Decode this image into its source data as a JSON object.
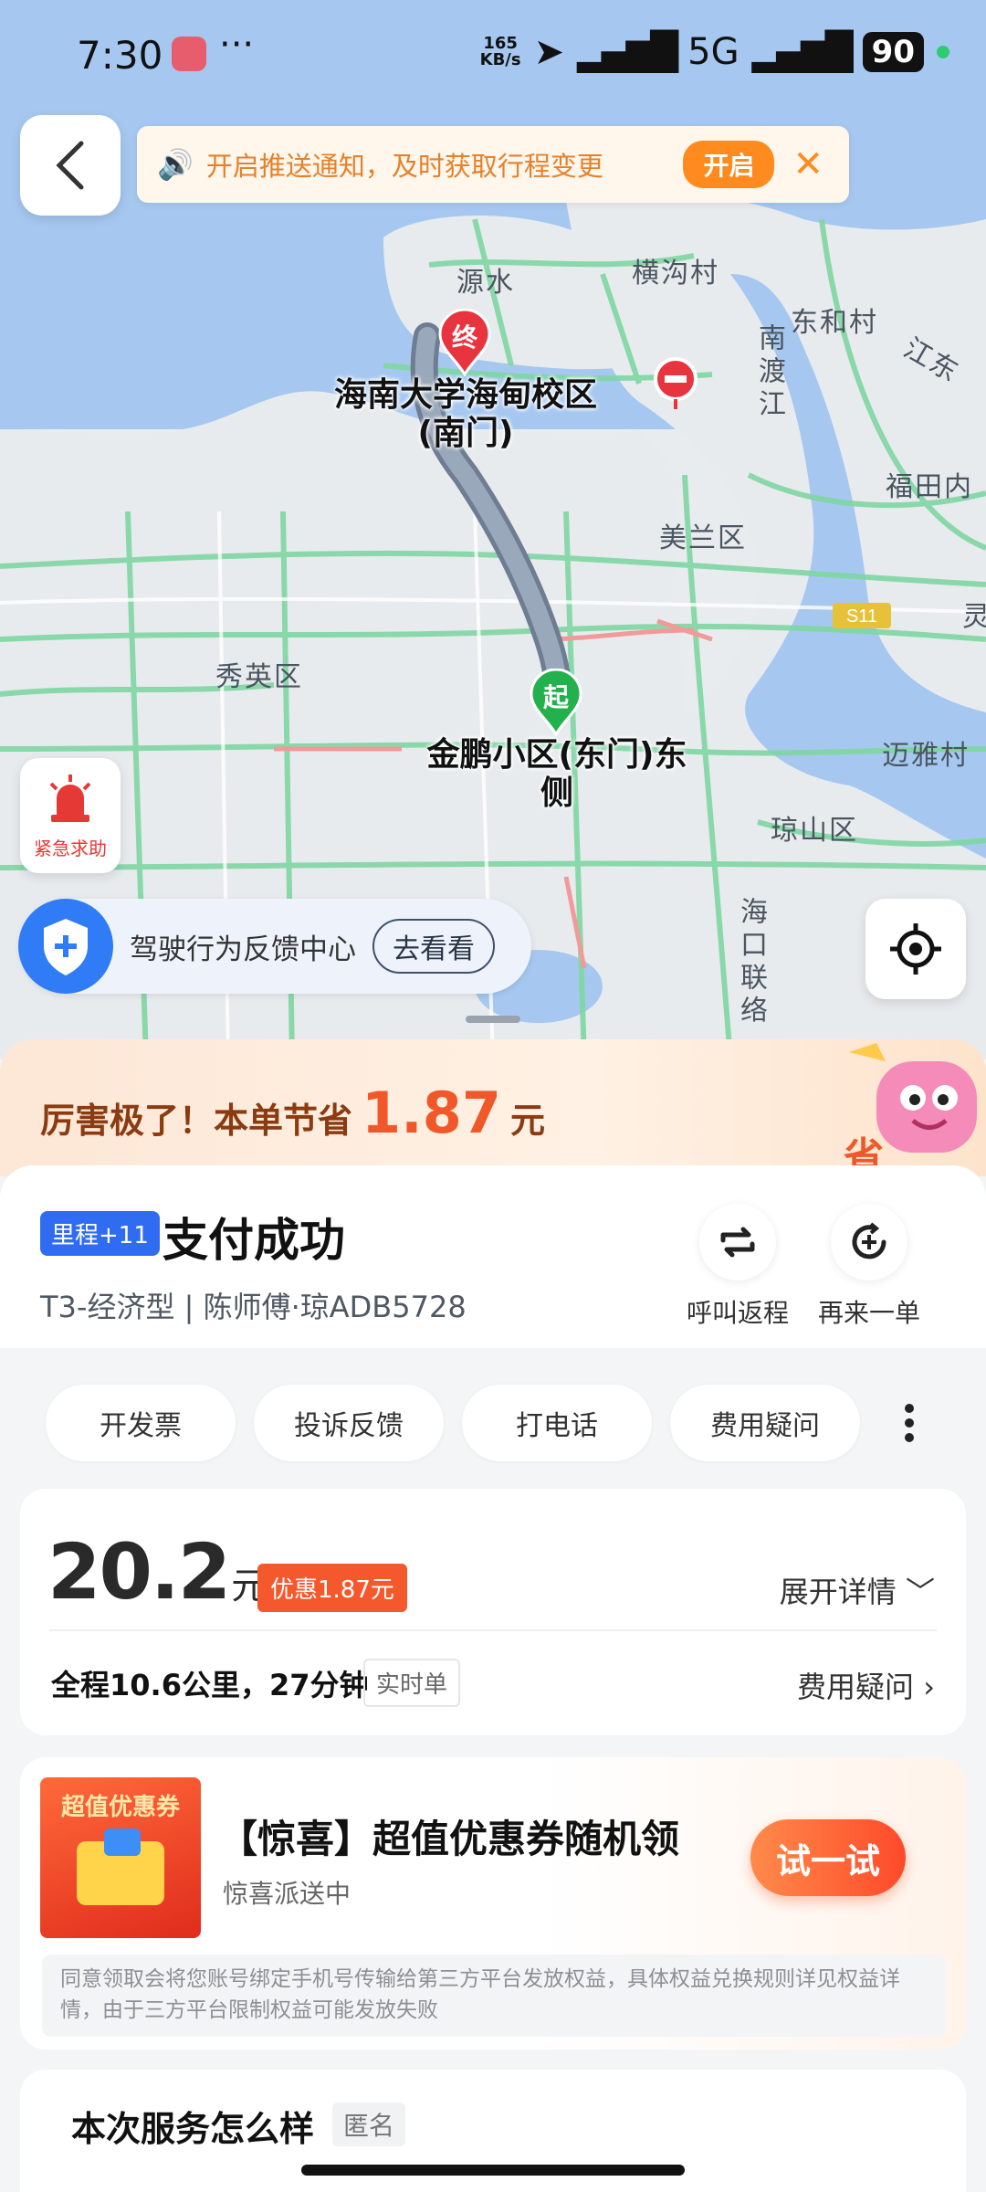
{
  "status_bar": {
    "time": "7:30",
    "speed": "165",
    "speed_unit": "KB/s",
    "network": "5G",
    "battery": "90"
  },
  "notice": {
    "text": "开启推送通知，及时获取行程变更",
    "button": "开启"
  },
  "map": {
    "places": [
      "源水",
      "横沟村",
      "东和村",
      "南渡江",
      "江东",
      "福田内",
      "美兰区",
      "灵",
      "秀英区",
      "迈雅村",
      "琼山区",
      "海口联络"
    ],
    "end_badge": "终",
    "start_badge": "起",
    "end_name": "海南大学海甸校区(南门)",
    "start_name": "金鹏小区(东门)东侧",
    "road_sign": "S11"
  },
  "sos": {
    "label": "紧急求助"
  },
  "feedback": {
    "text": "驾驶行为反馈中心",
    "button": "去看看"
  },
  "savings": {
    "prefix": "厉害极了！本单节省",
    "amount": "1.87",
    "unit": "元"
  },
  "order": {
    "badge": "里程+11",
    "title": "支付成功",
    "driver_info": "T3-经济型 | 陈师傅·琼ADB5728",
    "actions": [
      {
        "label": "呼叫返程"
      },
      {
        "label": "再来一单"
      }
    ],
    "chips": [
      "开发票",
      "投诉反馈",
      "打电话",
      "费用疑问"
    ]
  },
  "fare": {
    "amount": "20.2",
    "unit": "元",
    "discount": "优惠1.87元",
    "expand": "展开详情",
    "trip": "全程10.6公里，27分钟",
    "tag": "实时单",
    "fee_question": "费用疑问"
  },
  "promo": {
    "image_title": "超值优惠券",
    "title": "【惊喜】超值优惠券随机领",
    "subtitle": "惊喜派送中",
    "button": "试一试",
    "legal": "同意领取会将您账号绑定手机号传输给第三方平台发放权益，具体权益兑换规则详见权益详情，由于三方平台限制权益可能发放失败"
  },
  "rating": {
    "title": "本次服务怎么样",
    "anonymous": "匿名"
  },
  "colors": {
    "accent_orange": "#ff8a1e",
    "price_red": "#f0582a",
    "route": "#8d9aab",
    "start_green": "#22b14c",
    "end_red": "#e8343f"
  }
}
